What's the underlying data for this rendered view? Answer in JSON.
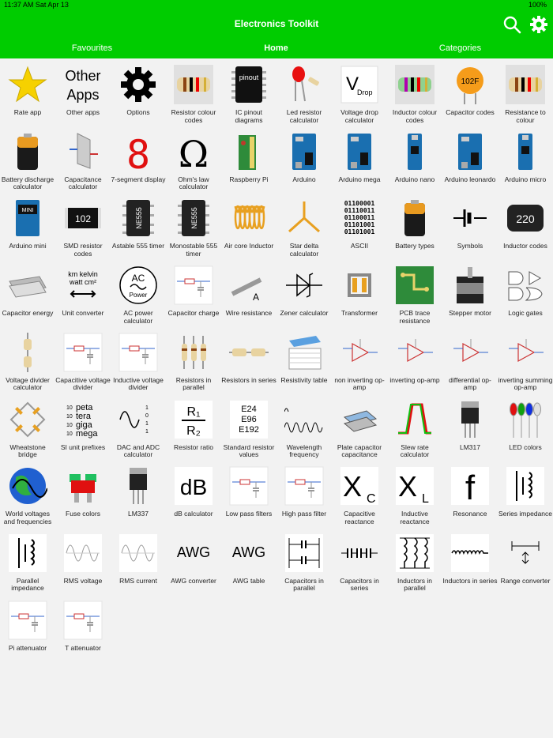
{
  "status": {
    "time": "11:37 AM  Sat Apr 13",
    "battery": "100%"
  },
  "nav": {
    "title": "Electronics Toolkit"
  },
  "tabs": [
    "Favourites",
    "Home",
    "Categories"
  ],
  "colors": {
    "accent": "#00cc00"
  },
  "items": [
    {
      "label": "Rate app",
      "icon": "star-icon"
    },
    {
      "label": "Other apps",
      "icon": "other-apps-icon",
      "glyph": "Other Apps"
    },
    {
      "label": "Options",
      "icon": "gear-icon"
    },
    {
      "label": "Resistor colour codes",
      "icon": "resistor-icon"
    },
    {
      "label": "IC pinout diagrams",
      "icon": "ic-chip-icon",
      "glyph": "pinout"
    },
    {
      "label": "Led resistor calculator",
      "icon": "led-icon"
    },
    {
      "label": "Voltage drop calculator",
      "icon": "voltage-drop-icon",
      "glyph": "V Drop"
    },
    {
      "label": "Inductor colour codes",
      "icon": "inductor-icon"
    },
    {
      "label": "Capacitor codes",
      "icon": "capacitor-code-icon",
      "glyph": "102F"
    },
    {
      "label": "Resistance to colour",
      "icon": "resistor-icon"
    },
    {
      "label": "Battery discharge calculator",
      "icon": "battery-icon"
    },
    {
      "label": "Capacitance calculator",
      "icon": "capacitance-icon"
    },
    {
      "label": "7-segment display",
      "icon": "seven-segment-icon",
      "glyph": "8"
    },
    {
      "label": "Ohm's law calculator",
      "icon": "ohm-icon",
      "glyph": "Ω"
    },
    {
      "label": "Raspberry Pi",
      "icon": "raspberry-pi-icon"
    },
    {
      "label": "Arduino",
      "icon": "arduino-icon"
    },
    {
      "label": "Arduino mega",
      "icon": "arduino-icon"
    },
    {
      "label": "Arduino nano",
      "icon": "arduino-nano-icon"
    },
    {
      "label": "Arduino leonardo",
      "icon": "arduino-icon"
    },
    {
      "label": "Arduino micro",
      "icon": "arduino-nano-icon"
    },
    {
      "label": "Arduino mini",
      "icon": "arduino-mini-icon"
    },
    {
      "label": "SMD resistor codes",
      "icon": "smd-resistor-icon",
      "glyph": "102"
    },
    {
      "label": "Astable 555 timer",
      "icon": "chip-555-icon",
      "glyph": "NE555"
    },
    {
      "label": "Monostable 555 timer",
      "icon": "chip-555-icon",
      "glyph": "NE555"
    },
    {
      "label": "Air core Inductor",
      "icon": "coil-icon"
    },
    {
      "label": "Star delta calculator",
      "icon": "star-delta-icon"
    },
    {
      "label": "ASCII",
      "icon": "ascii-icon",
      "glyph": "01100001 01110011 01100011 01101001 01101001"
    },
    {
      "label": "Battery types",
      "icon": "battery-icon"
    },
    {
      "label": "Symbols",
      "icon": "symbols-icon"
    },
    {
      "label": "Inductor codes",
      "icon": "inductor-code-icon",
      "glyph": "220"
    },
    {
      "label": "Capacitor energy",
      "icon": "capacitor-energy-icon"
    },
    {
      "label": "Unit converter",
      "icon": "unit-converter-icon",
      "glyph": "km kelvin watt cm²"
    },
    {
      "label": "AC power calculator",
      "icon": "ac-power-icon",
      "glyph": "AC Power"
    },
    {
      "label": "Capacitor charge",
      "icon": "circuit-icon"
    },
    {
      "label": "Wire resistance",
      "icon": "wire-icon"
    },
    {
      "label": "Zener calculator",
      "icon": "zener-icon"
    },
    {
      "label": "Transformer",
      "icon": "transformer-icon"
    },
    {
      "label": "PCB trace resistance",
      "icon": "pcb-icon"
    },
    {
      "label": "Stepper motor",
      "icon": "motor-icon"
    },
    {
      "label": "Logic gates",
      "icon": "logic-gates-icon"
    },
    {
      "label": "Voltage divider calculator",
      "icon": "voltage-divider-icon"
    },
    {
      "label": "Capacitive voltage divider",
      "icon": "circuit-icon"
    },
    {
      "label": "Inductive voltage divider",
      "icon": "circuit-icon"
    },
    {
      "label": "Resistors in parallel",
      "icon": "resistors-parallel-icon"
    },
    {
      "label": "Resistors in series",
      "icon": "resistors-series-icon"
    },
    {
      "label": "Resistivity table",
      "icon": "table-icon"
    },
    {
      "label": "non inverting op-amp",
      "icon": "opamp-icon"
    },
    {
      "label": "inverting op-amp",
      "icon": "opamp-icon"
    },
    {
      "label": "differential op-amp",
      "icon": "opamp-icon"
    },
    {
      "label": "inverting summing op-amp",
      "icon": "opamp-icon"
    },
    {
      "label": "Wheatstone bridge",
      "icon": "wheatstone-icon"
    },
    {
      "label": "SI unit prefixes",
      "icon": "si-prefix-icon",
      "glyph": "peta tera giga mega"
    },
    {
      "label": "DAC and ADC calculator",
      "icon": "dac-adc-icon"
    },
    {
      "label": "Resistor ratio",
      "icon": "ratio-icon",
      "glyph": "R1 / R2"
    },
    {
      "label": "Standard resistor values",
      "icon": "standard-values-icon",
      "glyph": "E24 E96 E192"
    },
    {
      "label": "Wavelength frequency",
      "icon": "wave-icon"
    },
    {
      "label": "Plate capacitor capacitance",
      "icon": "plate-capacitor-icon"
    },
    {
      "label": "Slew rate calculator",
      "icon": "slew-rate-icon"
    },
    {
      "label": "LM317",
      "icon": "regulator-icon"
    },
    {
      "label": "LED colors",
      "icon": "led-colors-icon"
    },
    {
      "label": "World voltages and frequencies",
      "icon": "globe-icon"
    },
    {
      "label": "Fuse colors",
      "icon": "fuse-icon"
    },
    {
      "label": "LM337",
      "icon": "regulator-icon"
    },
    {
      "label": "dB calculator",
      "icon": "db-icon",
      "glyph": "dB"
    },
    {
      "label": "Low pass filters",
      "icon": "circuit-icon"
    },
    {
      "label": "High pass filter",
      "icon": "circuit-icon"
    },
    {
      "label": "Capacitive reactance",
      "icon": "reactance-icon",
      "glyph": "XC"
    },
    {
      "label": "Inductive reactance",
      "icon": "reactance-icon",
      "glyph": "XL"
    },
    {
      "label": "Resonance",
      "icon": "resonance-icon",
      "glyph": "f"
    },
    {
      "label": "Series impedance",
      "icon": "impedance-icon"
    },
    {
      "label": "Parallel impedance",
      "icon": "impedance-icon"
    },
    {
      "label": "RMS voltage",
      "icon": "rms-icon"
    },
    {
      "label": "RMS current",
      "icon": "rms-icon"
    },
    {
      "label": "AWG converter",
      "icon": "awg-icon",
      "glyph": "AWG"
    },
    {
      "label": "AWG table",
      "icon": "awg-icon",
      "glyph": "AWG"
    },
    {
      "label": "Capacitors in parallel",
      "icon": "capacitors-parallel-icon"
    },
    {
      "label": "Capacitors in series",
      "icon": "capacitors-series-icon"
    },
    {
      "label": "Inductors in parallel",
      "icon": "inductors-parallel-icon"
    },
    {
      "label": "Inductors in series",
      "icon": "inductors-series-icon"
    },
    {
      "label": "Range converter",
      "icon": "range-icon"
    },
    {
      "label": "Pi attenuator",
      "icon": "circuit-icon"
    },
    {
      "label": "T attenuator",
      "icon": "circuit-icon"
    }
  ]
}
